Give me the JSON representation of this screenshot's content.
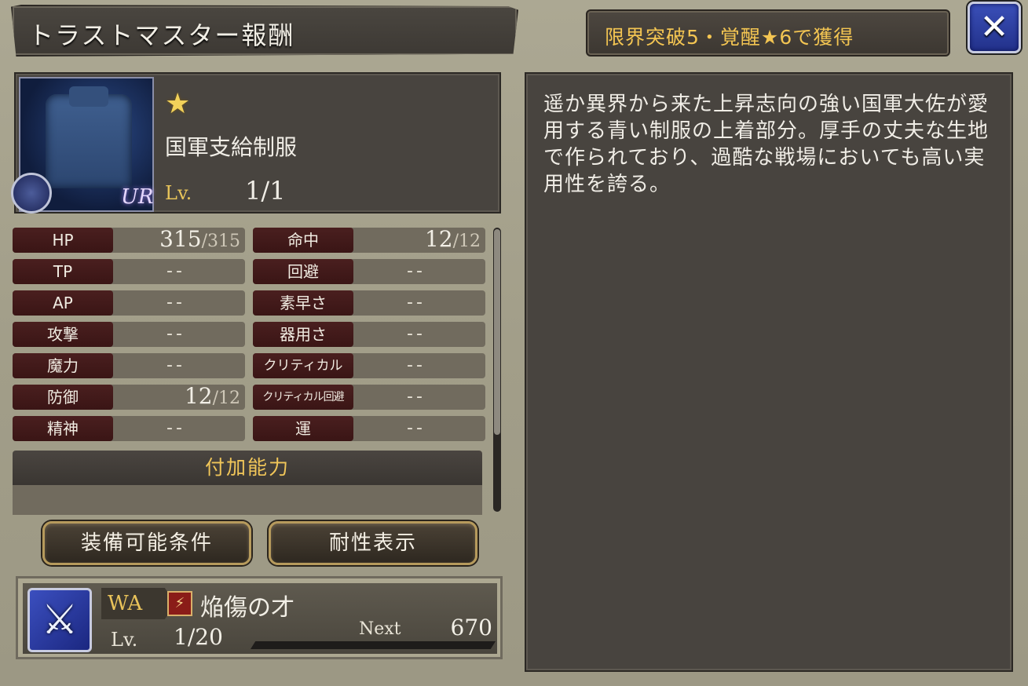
{
  "header": {
    "title": "トラストマスター報酬",
    "condition": "限界突破5・覚醒★6で獲得",
    "close_label": "✕"
  },
  "item": {
    "rarity_star": "★",
    "name": "国軍支給制服",
    "lv_label": "Lv.",
    "lv_value": "1/1",
    "rank_mark": "UR"
  },
  "stats": [
    {
      "label": "HP",
      "value": "315",
      "max": "/315"
    },
    {
      "label": "命中",
      "value": "12",
      "max": "/12"
    },
    {
      "label": "TP",
      "dash": "--"
    },
    {
      "label": "回避",
      "dash": "--"
    },
    {
      "label": "AP",
      "dash": "--"
    },
    {
      "label": "素早さ",
      "dash": "--"
    },
    {
      "label": "攻撃",
      "dash": "--"
    },
    {
      "label": "器用さ",
      "dash": "--"
    },
    {
      "label": "魔力",
      "dash": "--"
    },
    {
      "label": "クリティカル",
      "dash": "--"
    },
    {
      "label": "防御",
      "value": "12",
      "max": "/12"
    },
    {
      "label": "クリティカル回避",
      "dash": "--"
    },
    {
      "label": "精神",
      "dash": "--"
    },
    {
      "label": "運",
      "dash": "--"
    }
  ],
  "ability": {
    "header": "付加能力"
  },
  "buttons": {
    "equip_conditions": "装備可能条件",
    "resistance": "耐性表示"
  },
  "wa": {
    "tag": "WA",
    "element_icon": "flame-slash-icon",
    "element_glyph": "⚔",
    "name": "焔傷の才",
    "lv_label": "Lv.",
    "lv_value": "1/20",
    "next_label": "Next",
    "next_value": "670",
    "exp_progress": 0.0
  },
  "description": "遥か異界から来た上昇志向の強い国軍大佐が愛用する青い制服の上着部分。厚手の丈夫な生地で作られており、過酷な戦場においても高い実用性を誇る。",
  "colors": {
    "accent_gold": "#f1c659",
    "stat_label_bg": "#3a1515",
    "close_blue": "#2a3a9a"
  }
}
